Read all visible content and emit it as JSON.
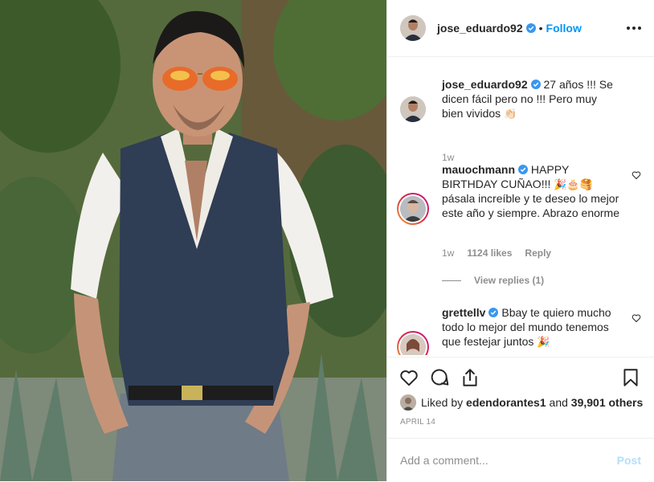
{
  "post": {
    "username": "jose_eduardo92",
    "follow_label": "Follow",
    "separator": "•"
  },
  "comments": [
    {
      "username": "jose_eduardo92",
      "text": "27 años !!! Se dicen fácil pero no !!! Pero muy bien vividos",
      "emoji": "👏🏻",
      "time": "1w"
    },
    {
      "username": "mauochmann",
      "text_line1": "HAPPY BIRTHDAY CUÑAO!!!",
      "emoji1": "🎉🎂🥞",
      "text_line2": "pásala increíble y te deseo lo mejor este año y siempre. Abrazo enorme",
      "time": "1w",
      "likes": "1124 likes",
      "reply_label": "Reply",
      "view_replies": "View replies (1)"
    },
    {
      "username": "grettellv",
      "text": "Bbay te quiero mucho todo lo mejor del mundo tenemos que festejar juntos",
      "emoji": "🎉"
    }
  ],
  "actions": {
    "icons": [
      "heart-icon",
      "comment-icon",
      "share-icon",
      "bookmark-icon"
    ]
  },
  "likes": {
    "prefix": "Liked by ",
    "user": "edendorantes1",
    "middle": " and ",
    "count": "39,901 others"
  },
  "date": "APRIL 14",
  "add_comment": {
    "placeholder": "Add a comment...",
    "post_label": "Post"
  },
  "colors": {
    "accent": "#0095f6",
    "muted": "#8e8e8e",
    "text": "#262626",
    "post_disabled": "#b2dffc"
  }
}
